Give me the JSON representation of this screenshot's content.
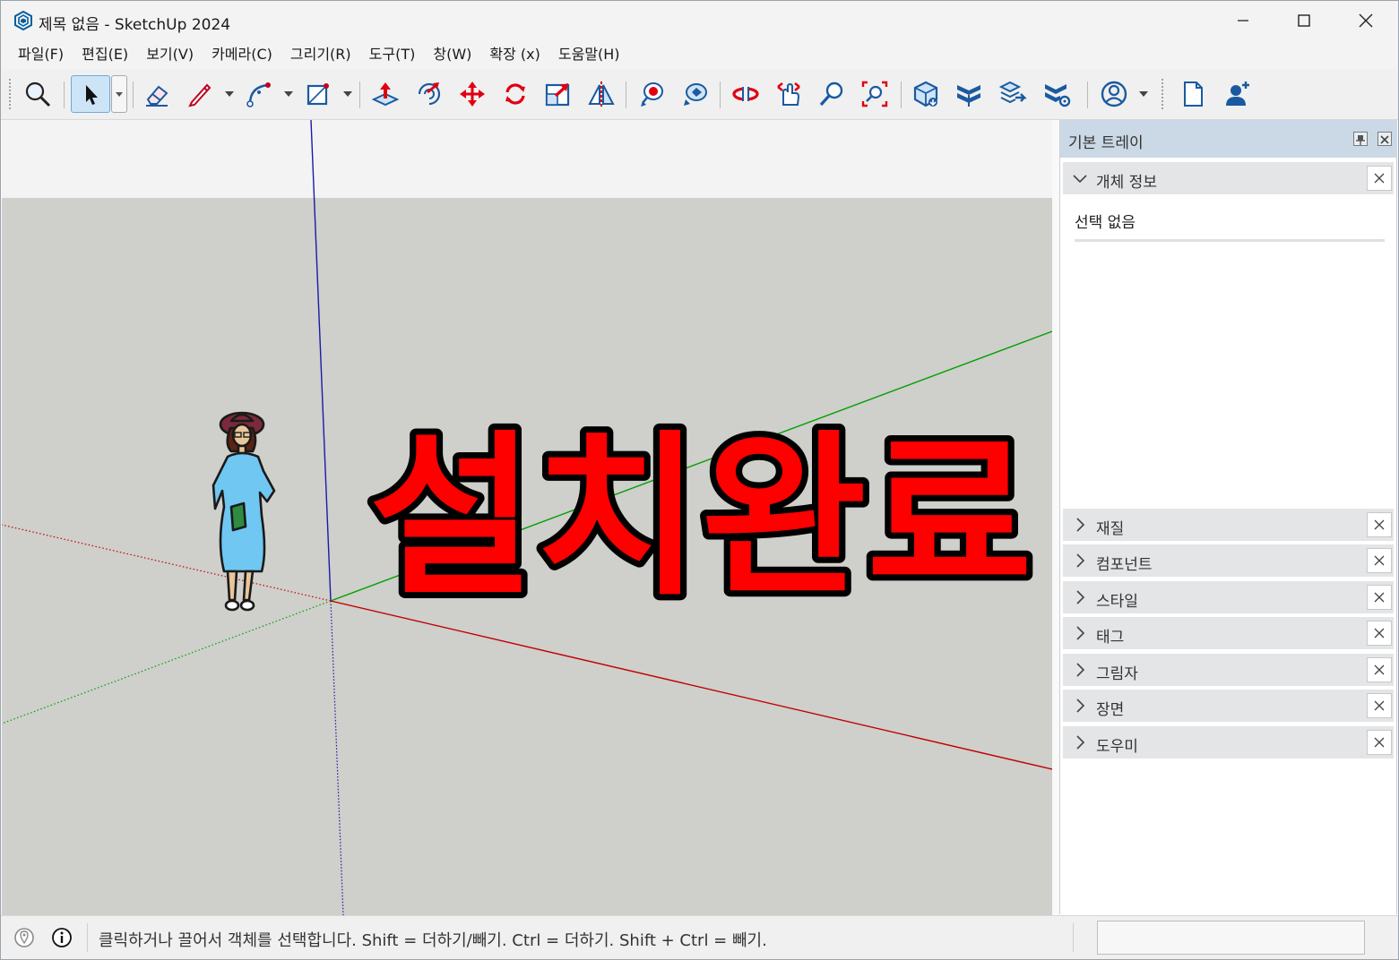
{
  "window": {
    "title": "제목 없음 - SketchUp 2024",
    "minimize_glyph": "—",
    "maximize_glyph": "☐",
    "close_glyph": "✕"
  },
  "menu": {
    "items": [
      {
        "label": "파일(F)"
      },
      {
        "label": "편집(E)"
      },
      {
        "label": "보기(V)"
      },
      {
        "label": "카메라(C)"
      },
      {
        "label": "그리기(R)"
      },
      {
        "label": "도구(T)"
      },
      {
        "label": "창(W)"
      },
      {
        "label": "확장 (x)"
      },
      {
        "label": "도움말(H)"
      }
    ]
  },
  "toolbar": {
    "tools": [
      {
        "icon": "search-icon"
      },
      {
        "icon": "select-arrow-icon",
        "active": true
      },
      {
        "icon": "eraser-icon"
      },
      {
        "icon": "pencil-icon"
      },
      {
        "icon": "arc-icon"
      },
      {
        "icon": "rectangle-icon"
      },
      {
        "icon": "push-pull-icon"
      },
      {
        "icon": "offset-icon"
      },
      {
        "icon": "move-icon"
      },
      {
        "icon": "rotate-icon"
      },
      {
        "icon": "scale-icon"
      },
      {
        "icon": "flip-icon"
      },
      {
        "icon": "paint-bucket-icon"
      },
      {
        "icon": "tag-tool-icon"
      },
      {
        "icon": "orbit-icon"
      },
      {
        "icon": "pan-icon"
      },
      {
        "icon": "zoom-icon"
      },
      {
        "icon": "zoom-extents-icon"
      },
      {
        "icon": "3d-warehouse-icon"
      },
      {
        "icon": "extension-warehouse-icon"
      },
      {
        "icon": "layout-send-icon"
      },
      {
        "icon": "extension-manager-icon"
      },
      {
        "icon": "account-icon"
      },
      {
        "icon": "new-file-icon"
      },
      {
        "icon": "add-user-icon"
      }
    ]
  },
  "viewport": {
    "banner_text": "설치완료",
    "colors": {
      "background": "#cfcfcb",
      "sky": "#f3f3f3",
      "axis_blue": "#1a1aa8",
      "axis_red": "#c00000",
      "axis_green": "#00a000",
      "banner_fill": "#ff0000",
      "banner_stroke": "#000000"
    }
  },
  "tray": {
    "title": "기본 트레이",
    "entity_info": {
      "label": "개체 정보",
      "value": "선택 없음"
    },
    "panels": [
      {
        "label": "재질"
      },
      {
        "label": "컴포넌트"
      },
      {
        "label": "스타일"
      },
      {
        "label": "태그"
      },
      {
        "label": "그림자"
      },
      {
        "label": "장면"
      },
      {
        "label": "도우미"
      }
    ]
  },
  "statusbar": {
    "text": "클릭하거나 끌어서 객체를 선택합니다. Shift = 더하기/빼기. Ctrl = 더하기. Shift + Ctrl = 빼기.",
    "measurements_value": ""
  }
}
